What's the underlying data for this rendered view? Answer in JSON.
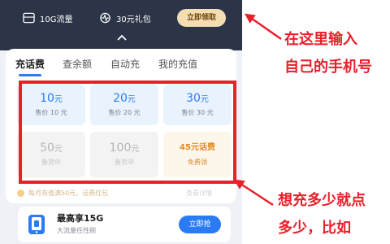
{
  "header": {
    "perks": [
      {
        "icon": "sim-card-icon",
        "label": "10G流量"
      },
      {
        "icon": "pulse-icon",
        "label": "30元礼包"
      }
    ],
    "claim_label": "立即领取"
  },
  "tabs": [
    {
      "label": "充话费",
      "active": true
    },
    {
      "label": "查余额",
      "active": false
    },
    {
      "label": "自动充",
      "active": false
    },
    {
      "label": "我的充值",
      "active": false
    }
  ],
  "options": [
    {
      "amount": "10",
      "unit": "元",
      "sub": "售价 10 元",
      "state": "available"
    },
    {
      "amount": "20",
      "unit": "元",
      "sub": "售价 20 元",
      "state": "available"
    },
    {
      "amount": "30",
      "unit": "元",
      "sub": "售价 30 元",
      "state": "available"
    },
    {
      "amount": "50",
      "unit": "元",
      "sub": "备货中",
      "state": "out-of-stock"
    },
    {
      "amount": "100",
      "unit": "元",
      "sub": "备货中",
      "state": "out-of-stock"
    },
    {
      "title": "45元话费",
      "sub": "免费领",
      "state": "promo"
    }
  ],
  "notice": {
    "left": "每月充值满50元，话费红包",
    "right": "查看详情"
  },
  "promo": {
    "title": "最高享15G",
    "subtitle": "大流量任性刷",
    "button": "立即抢"
  },
  "annotations": {
    "top": [
      "在这里输入",
      "自己的手机号"
    ],
    "bottom": [
      "想充多少就点",
      "多少，比如"
    ]
  },
  "colors": {
    "accent": "#2b7cf4",
    "annotation": "#e8202a",
    "header_bg": "#2c3447",
    "promo_text": "#e38d1c"
  }
}
